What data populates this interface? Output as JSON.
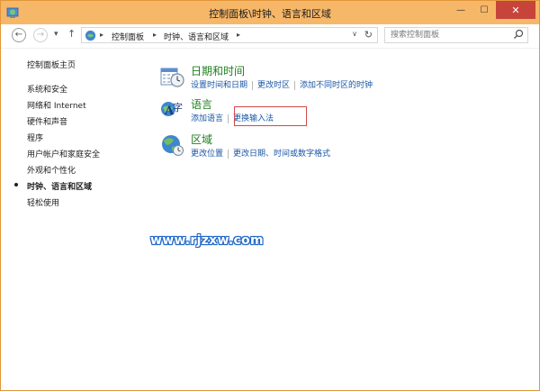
{
  "window": {
    "title": "控制面板\\时钟、语言和区域",
    "controls": {
      "minimize": "—",
      "maximize": "☐",
      "close": "✕"
    }
  },
  "addressbar": {
    "back": "←",
    "forward": "→",
    "recent": "▾",
    "up": "↑",
    "breadcrumbs": [
      "控制面板",
      "时钟、语言和区域"
    ],
    "separator": "▸",
    "dropdown": "∨",
    "refresh": "↻",
    "search_placeholder": "搜索控制面板"
  },
  "sidebar": {
    "items": [
      {
        "label": "控制面板主页",
        "active": false
      },
      {
        "label": "系统和安全",
        "active": false
      },
      {
        "label": "网络和 Internet",
        "active": false
      },
      {
        "label": "硬件和声音",
        "active": false
      },
      {
        "label": "程序",
        "active": false
      },
      {
        "label": "用户帐户和家庭安全",
        "active": false
      },
      {
        "label": "外观和个性化",
        "active": false
      },
      {
        "label": "时钟、语言和区域",
        "active": true
      },
      {
        "label": "轻松使用",
        "active": false
      }
    ]
  },
  "categories": [
    {
      "title": "日期和时间",
      "icon": "clock-calendar-icon",
      "links": [
        "设置时间和日期",
        "更改时区",
        "添加不同时区的时钟"
      ]
    },
    {
      "title": "语言",
      "icon": "language-icon",
      "links": [
        "添加语言",
        "更换输入法"
      ]
    },
    {
      "title": "区域",
      "icon": "globe-clock-icon",
      "links": [
        "更改位置",
        "更改日期、时间或数字格式"
      ]
    }
  ],
  "watermark": "www.rjzxw.com",
  "colors": {
    "titlebar": "#f7b768",
    "category_title": "#1e7f1e",
    "link": "#1a56a6",
    "highlight_box": "#d44a4a"
  }
}
